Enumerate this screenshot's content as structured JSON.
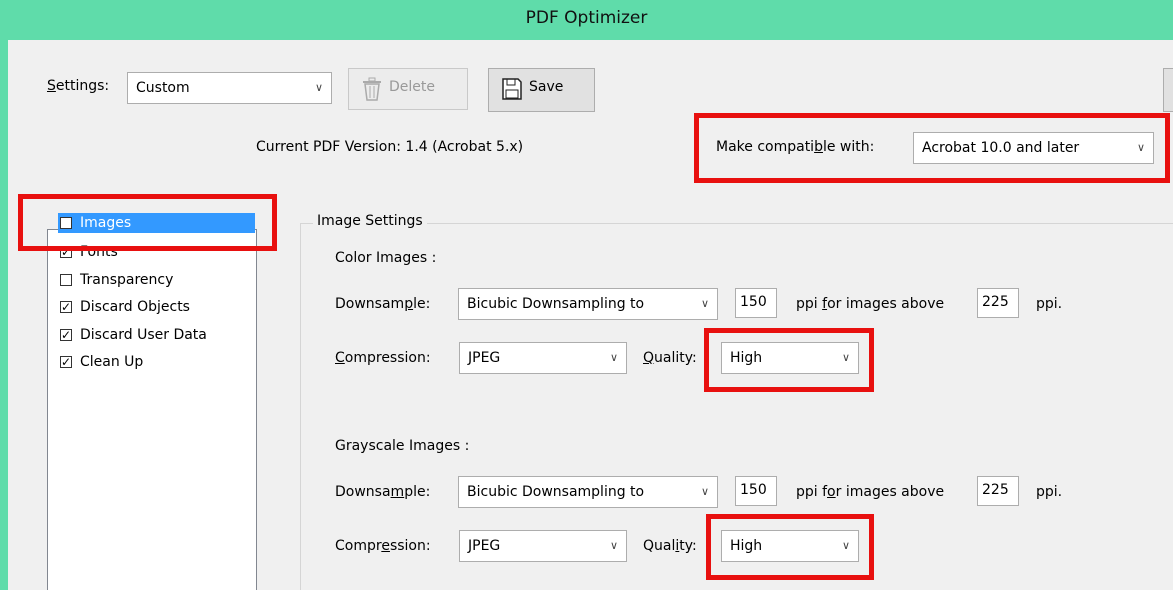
{
  "window": {
    "title": "PDF Optimizer"
  },
  "settings": {
    "label_pre": "",
    "label_under": "S",
    "label_post": "ettings:",
    "value": "Custom",
    "delete_label": "Delete",
    "save_label": "Save"
  },
  "version": {
    "current": "Current PDF Version: 1.4 (Acrobat 5.x)",
    "compat_pre": "Make compati",
    "compat_under": "b",
    "compat_post": "le with:",
    "compat_value": "Acrobat 10.0 and later"
  },
  "panels": [
    {
      "label": "Images",
      "checked": true,
      "selected": true
    },
    {
      "label": "Fonts",
      "checked": true,
      "selected": false
    },
    {
      "label": "Transparency",
      "checked": false,
      "selected": false
    },
    {
      "label": "Discard Objects",
      "checked": true,
      "selected": false
    },
    {
      "label": "Discard User Data",
      "checked": true,
      "selected": false
    },
    {
      "label": "Clean Up",
      "checked": true,
      "selected": false
    }
  ],
  "image_settings": {
    "group_title": "Image Settings",
    "color": {
      "heading": "Color Images :",
      "downsample_pre": "Downsam",
      "downsample_under": "p",
      "downsample_post": "le:",
      "downsample_value": "Bicubic Downsampling to",
      "ppi": "150",
      "above_pre": "ppi ",
      "above_under": "f",
      "above_post": "or images above",
      "above_value": "225",
      "ppi_suffix": "ppi.",
      "compression_pre": "",
      "compression_under": "C",
      "compression_post": "ompression:",
      "compression_value": "JPEG",
      "quality_pre": "",
      "quality_under": "Q",
      "quality_post": "uality:",
      "quality_value": "High"
    },
    "grayscale": {
      "heading": "Grayscale Images :",
      "downsample_pre": "Downsa",
      "downsample_under": "m",
      "downsample_post": "ple:",
      "downsample_value": "Bicubic Downsampling to",
      "ppi": "150",
      "above_pre": "ppi f",
      "above_under": "o",
      "above_post": "r images above",
      "above_value": "225",
      "ppi_suffix": "ppi.",
      "compression_pre": "Compr",
      "compression_under": "e",
      "compression_post": "ssion:",
      "compression_value": "JPEG",
      "quality_pre": "Qual",
      "quality_under": "i",
      "quality_post": "ty:",
      "quality_value": "High"
    }
  },
  "icons": {
    "dropdown": "chevron-down-icon",
    "delete": "trash-icon",
    "save": "floppy-disk-icon"
  },
  "colors": {
    "titlebar": "#5fdcaa",
    "highlight": "#e8100f",
    "selection": "#3399ff"
  }
}
